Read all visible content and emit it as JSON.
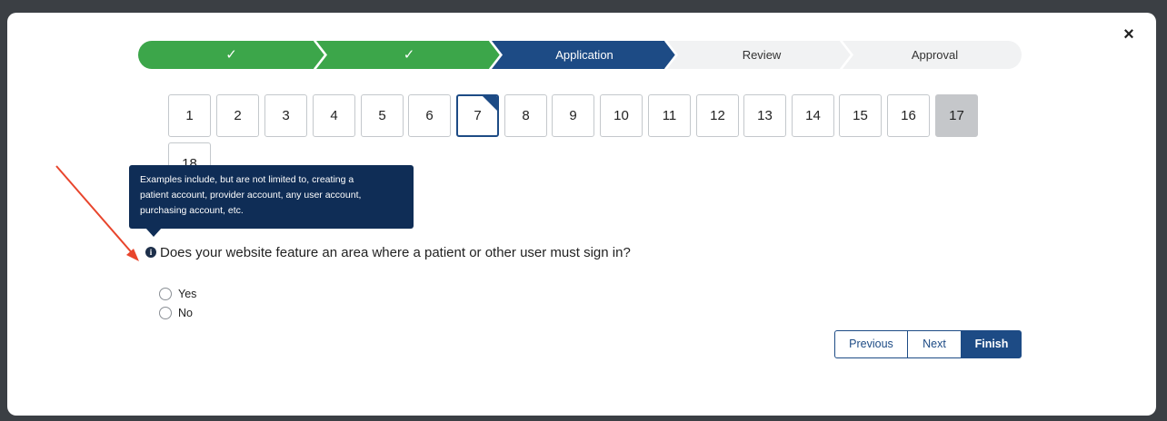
{
  "progress": {
    "steps": [
      {
        "label": "✓",
        "state": "complete"
      },
      {
        "label": "✓",
        "state": "complete"
      },
      {
        "label": "Application",
        "state": "current"
      },
      {
        "label": "Review",
        "state": "upcoming"
      },
      {
        "label": "Approval",
        "state": "upcoming"
      }
    ],
    "colors": {
      "complete": "#3ca64a",
      "current": "#1d4b85",
      "upcoming": "#f1f2f3"
    }
  },
  "pages": {
    "numbers": [
      "1",
      "2",
      "3",
      "4",
      "5",
      "6",
      "7",
      "8",
      "9",
      "10",
      "11",
      "12",
      "13",
      "14",
      "15",
      "16",
      "17",
      "18"
    ],
    "active": "7",
    "disabled": "17"
  },
  "tooltip": {
    "lines": [
      "Examples include, but are not limited to, creating a",
      "patient account, provider account, any user account,",
      "purchasing account, etc."
    ]
  },
  "question": {
    "icon": "info-icon",
    "text": "Does your website feature an area where a patient or other user must sign in?",
    "options": [
      "Yes",
      "No"
    ]
  },
  "nav": {
    "previous_label": "Previous",
    "next_label": "Next",
    "finish_label": "Finish"
  },
  "modal": {
    "close_label": "×"
  }
}
